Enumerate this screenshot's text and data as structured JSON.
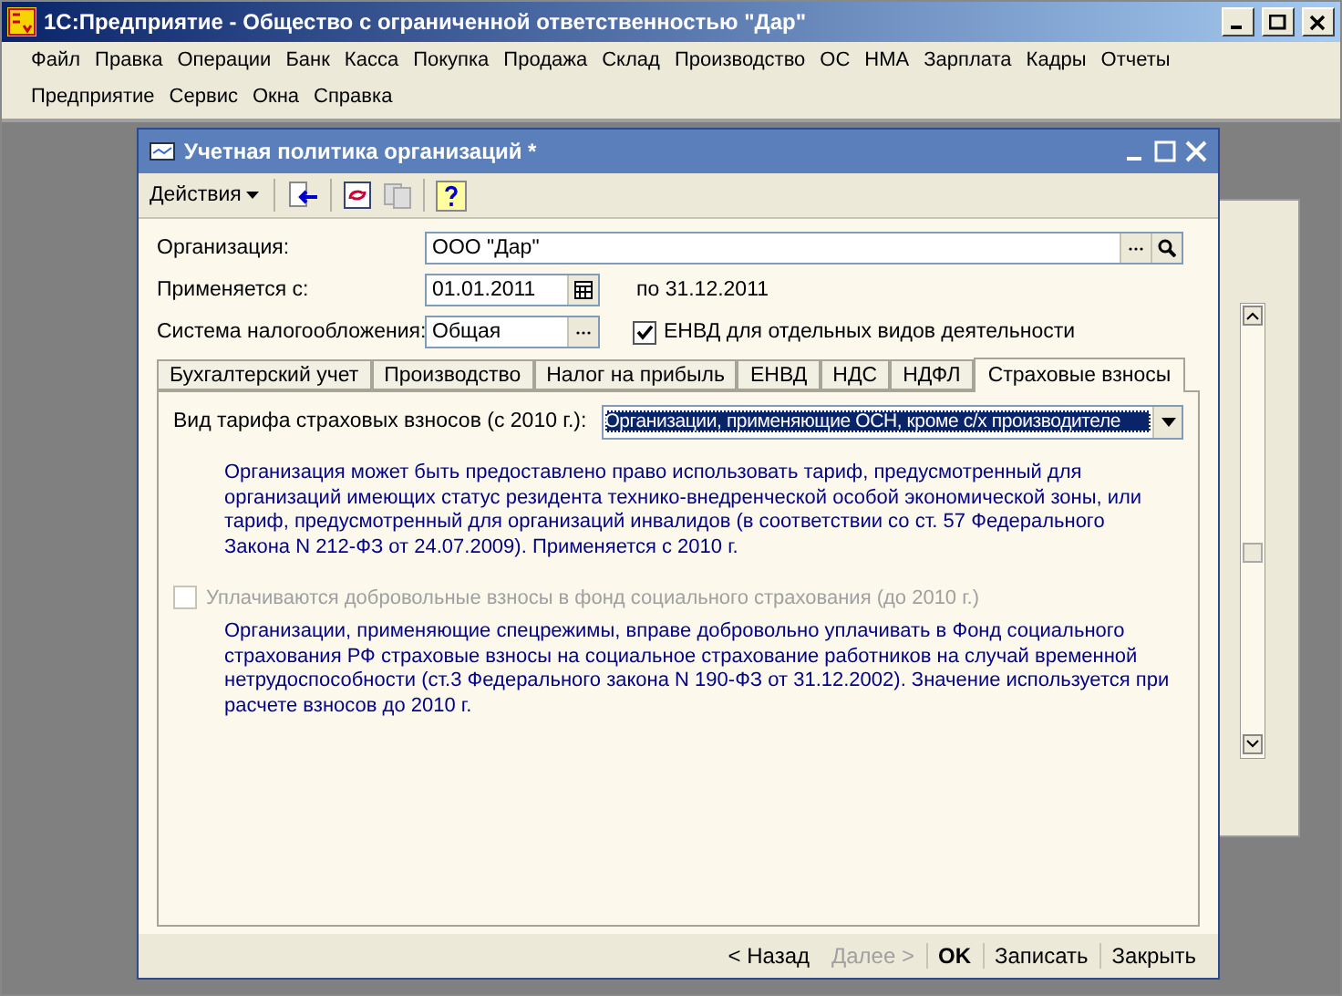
{
  "window": {
    "title": "1С:Предприятие - Общество с ограниченной ответственностью \"Дар\""
  },
  "menu_rows": [
    [
      "Файл",
      "Правка",
      "Операции",
      "Банк",
      "Касса",
      "Покупка",
      "Продажа",
      "Склад",
      "Производство",
      "ОС",
      "НМА",
      "Зарплата",
      "Кадры",
      "Отчеты"
    ],
    [
      "Предприятие",
      "Сервис",
      "Окна",
      "Справка"
    ]
  ],
  "dialog": {
    "title": "Учетная политика организаций *",
    "actions_menu": "Действия",
    "organization": {
      "label": "Организация:",
      "value": "ООО \"Дар\""
    },
    "applies_from": {
      "label": "Применяется с:",
      "value": "01.01.2011",
      "until": "по 31.12.2011"
    },
    "tax_system": {
      "label": "Система налогообложения:",
      "value": "Общая"
    },
    "envd": {
      "label": "ЕНВД для отдельных видов деятельности",
      "checked": true
    },
    "tabs": [
      {
        "label": "Бухгалтерский учет",
        "selected": false
      },
      {
        "label": "Производство",
        "selected": false
      },
      {
        "label": "Налог на прибыль",
        "selected": false
      },
      {
        "label": "ЕНВД",
        "selected": false
      },
      {
        "label": "НДС",
        "selected": false
      },
      {
        "label": "НДФЛ",
        "selected": false
      },
      {
        "label": "Страховые взносы",
        "selected": true
      }
    ],
    "tariff": {
      "label": "Вид тарифа страховых взносов (с 2010 г.):",
      "value": "Организации, применяющие ОСН, кроме с/х производителе"
    },
    "tariff_note": "Организация может быть предоставлено право использовать тариф, предусмотренный для организаций имеющих статус резидента технико-внедренческой особой экономической зоны, или тариф, предусмотренный для организаций инвалидов (в соответствии со ст. 57 Федерального Закона  N 212-ФЗ от 24.07.2009). Применяется с 2010 г.",
    "voluntary": {
      "label": "Уплачиваются добровольные взносы в фонд социального страхования (до 2010 г.)",
      "checked": false,
      "disabled": true
    },
    "voluntary_note": "Организации, применяющие спецрежимы, вправе добровольно уплачивать в Фонд социального страхования РФ страховые взносы на социальное страхование работников на случай временной нетрудоспособности (ст.3 Федерального закона N 190-ФЗ от 31.12.2002). Значение используется при расчете взносов до 2010 г.",
    "footer_buttons": [
      {
        "label": "< Назад",
        "kind": "normal",
        "disabled": false
      },
      {
        "label": "Далее >",
        "kind": "normal",
        "disabled": true
      },
      {
        "label": "OK",
        "kind": "default",
        "disabled": false
      },
      {
        "label": "Записать",
        "kind": "normal",
        "disabled": false
      },
      {
        "label": "Закрыть",
        "kind": "normal",
        "disabled": false
      }
    ]
  }
}
